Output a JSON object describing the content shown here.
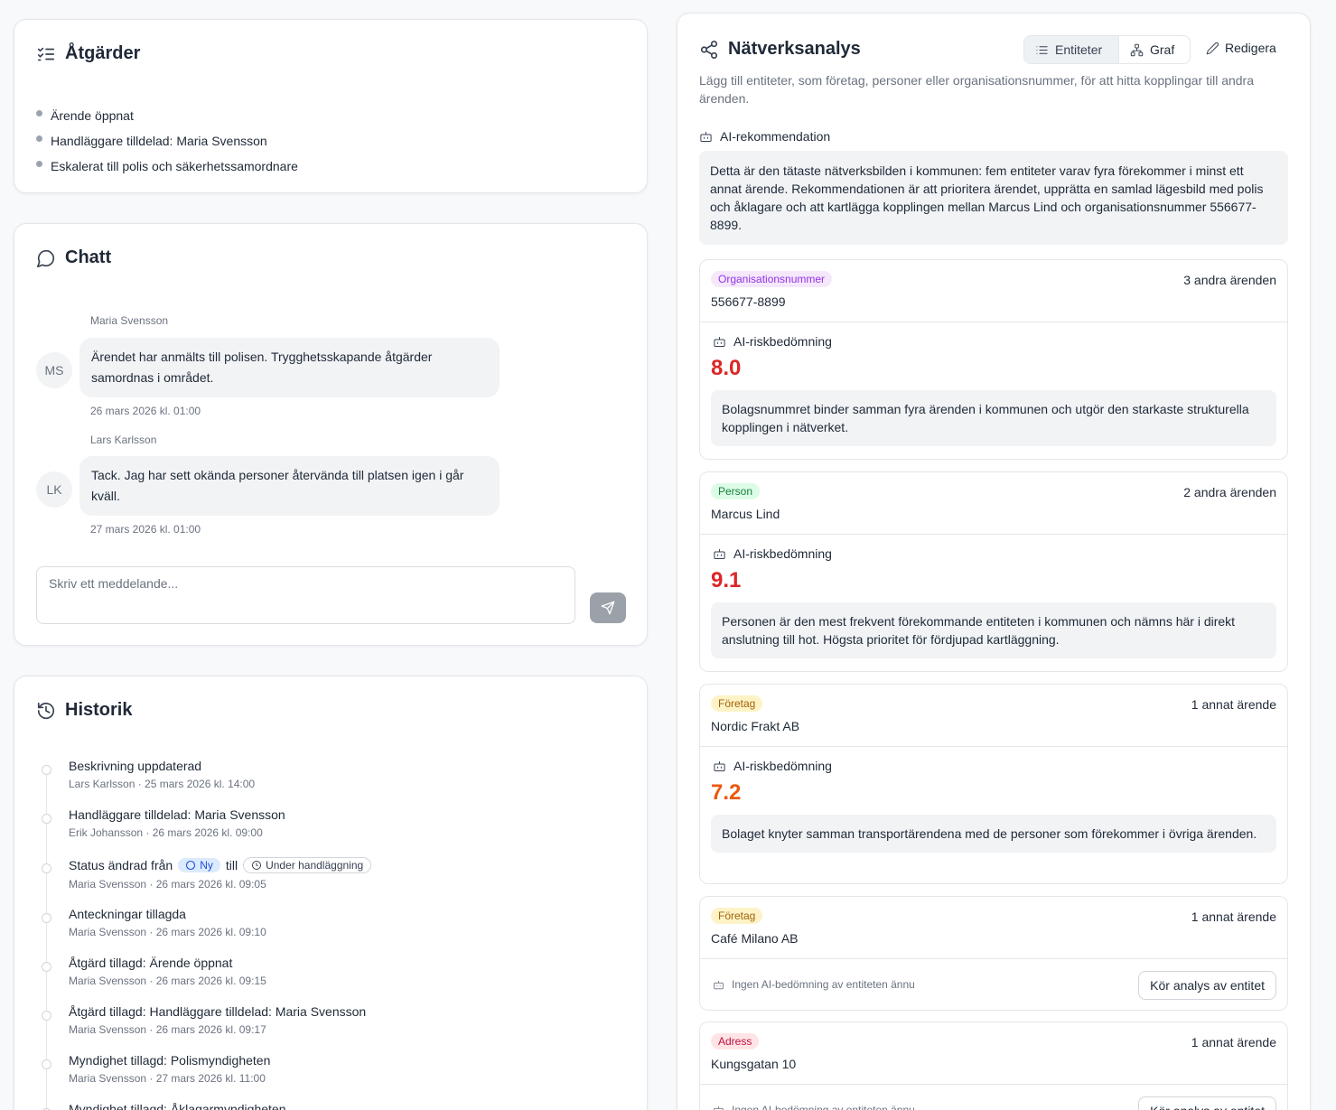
{
  "actions": {
    "title": "Åtgärder",
    "items": [
      "Ärende öppnat",
      "Handläggare tilldelad: Maria Svensson",
      "Eskalerat till polis och säkerhetssamordnare"
    ]
  },
  "chat": {
    "title": "Chatt",
    "messages": [
      {
        "author": "Maria Svensson",
        "initials": "MS",
        "text": "Ärendet har anmälts till polisen. Trygghetsskapande åtgärder samordnas i området.",
        "time": "26 mars 2026 kl. 01:00"
      },
      {
        "author": "Lars Karlsson",
        "initials": "LK",
        "text": "Tack. Jag har sett okända personer återvända till platsen igen i går kväll.",
        "time": "27 mars 2026 kl. 01:00"
      }
    ],
    "input_placeholder": "Skriv ett meddelande..."
  },
  "history": {
    "title": "Historik",
    "status_from_label": "Status ändrad från",
    "status_to_word": "till",
    "badge_new": "Ny",
    "badge_in_progress": "Under handläggning",
    "items": [
      {
        "title": "Beskrivning uppdaterad",
        "meta": "Lars Karlsson · 25 mars 2026 kl. 14:00"
      },
      {
        "title": "Handläggare tilldelad: Maria Svensson",
        "meta": "Erik Johansson · 26 mars 2026 kl. 09:00"
      },
      {
        "title": "",
        "meta": "Maria Svensson · 26 mars 2026 kl. 09:05"
      },
      {
        "title": "Anteckningar tillagda",
        "meta": "Maria Svensson · 26 mars 2026 kl. 09:10"
      },
      {
        "title": "Åtgärd tillagd: Ärende öppnat",
        "meta": "Maria Svensson · 26 mars 2026 kl. 09:15"
      },
      {
        "title": "Åtgärd tillagd: Handläggare tilldelad: Maria Svensson",
        "meta": "Maria Svensson · 26 mars 2026 kl. 09:17"
      },
      {
        "title": "Myndighet tillagd: Polismyndigheten",
        "meta": "Maria Svensson · 27 mars 2026 kl. 11:00"
      },
      {
        "title": "Myndighet tillagd: Åklagarmyndigheten",
        "meta": ""
      }
    ]
  },
  "network": {
    "title": "Nätverksanalys",
    "view_entities": "Entiteter",
    "view_graph": "Graf",
    "edit": "Redigera",
    "description": "Lägg till entiteter, som företag, personer eller organisationsnummer, för att hitta kopplingar till andra ärenden.",
    "ai_title": "AI-rekommendation",
    "ai_text": "Detta är den tätaste nätverksbilden i kommunen: fem entiteter varav fyra förekommer i minst ett annat ärende. Rekommendationen är att prioritera ärendet, upprätta en samlad lägesbild med polis och åklagare och att kartlägga kopplingen mellan Marcus Lind och organisationsnummer 556677-8899.",
    "risk_label": "AI-riskbedömning",
    "no_assessment": "Ingen AI-bedömning av entiteten ännu",
    "run_analysis": "Kör analys av entitet",
    "entities": [
      {
        "type": "Organisationsnummer",
        "name": "556677-8899",
        "count": "3 andra ärenden",
        "score": "8.0",
        "reason": "Bolagsnummret binder samman fyra ärenden i kommunen och utgör den starkaste strukturella kopplingen i nätverket."
      },
      {
        "type": "Person",
        "name": "Marcus Lind",
        "count": "2 andra ärenden",
        "score": "9.1",
        "reason": "Personen är den mest frekvent förekommande entiteten i kommunen och nämns här i direkt anslutning till hot. Högsta prioritet för fördjupad kartläggning."
      },
      {
        "type": "Företag",
        "name": "Nordic Frakt AB",
        "count": "1 annat ärende",
        "score": "7.2",
        "reason": "Bolaget knyter samman transportärendena med de personer som förekommer i övriga ärenden."
      },
      {
        "type": "Företag",
        "name": "Café Milano AB",
        "count": "1 annat ärende"
      },
      {
        "type": "Adress",
        "name": "Kungsgatan 10",
        "count": "1 annat ärende"
      }
    ]
  },
  "colors": {
    "score_high": "#dc2626",
    "score_medium": "#ea580c",
    "tag_org_bg": "#f5e8fb",
    "tag_org_fg": "#9333ea",
    "tag_person_bg": "#dcfce7",
    "tag_person_fg": "#15803d",
    "tag_company_bg": "#fef3c7",
    "tag_company_fg": "#a16207",
    "tag_address_bg": "#ffe4e6",
    "tag_address_fg": "#be123c"
  }
}
